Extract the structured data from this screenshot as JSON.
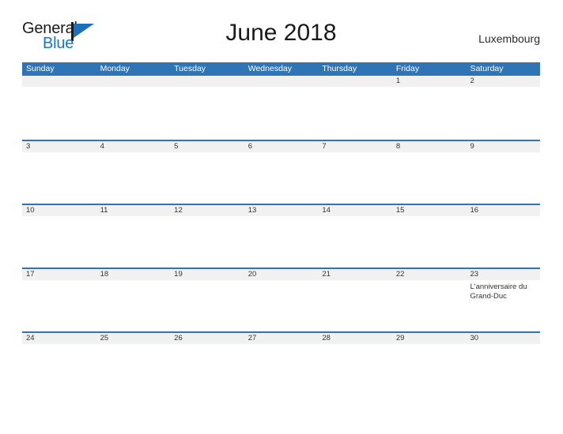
{
  "brand": {
    "word_one": "General",
    "word_two": "Blue",
    "flag_icon": "triangle-flag-icon",
    "accent_color": "#1378c8",
    "dark_color": "#1a1a1a"
  },
  "header": {
    "title": "June 2018",
    "region": "Luxembourg"
  },
  "calendar": {
    "header_bg": "#2f74b5",
    "band_bg": "#f1f1f1",
    "rule_color": "#2f74b5",
    "weekdays": [
      "Sunday",
      "Monday",
      "Tuesday",
      "Wednesday",
      "Thursday",
      "Friday",
      "Saturday"
    ],
    "weeks": [
      [
        {
          "day": ""
        },
        {
          "day": ""
        },
        {
          "day": ""
        },
        {
          "day": ""
        },
        {
          "day": ""
        },
        {
          "day": "1"
        },
        {
          "day": "2"
        }
      ],
      [
        {
          "day": "3"
        },
        {
          "day": "4"
        },
        {
          "day": "5"
        },
        {
          "day": "6"
        },
        {
          "day": "7"
        },
        {
          "day": "8"
        },
        {
          "day": "9"
        }
      ],
      [
        {
          "day": "10"
        },
        {
          "day": "11"
        },
        {
          "day": "12"
        },
        {
          "day": "13"
        },
        {
          "day": "14"
        },
        {
          "day": "15"
        },
        {
          "day": "16"
        }
      ],
      [
        {
          "day": "17"
        },
        {
          "day": "18"
        },
        {
          "day": "19"
        },
        {
          "day": "20"
        },
        {
          "day": "21"
        },
        {
          "day": "22"
        },
        {
          "day": "23",
          "event": "L'anniversaire du Grand-Duc"
        }
      ],
      [
        {
          "day": "24"
        },
        {
          "day": "25"
        },
        {
          "day": "26"
        },
        {
          "day": "27"
        },
        {
          "day": "28"
        },
        {
          "day": "29"
        },
        {
          "day": "30"
        }
      ]
    ]
  }
}
